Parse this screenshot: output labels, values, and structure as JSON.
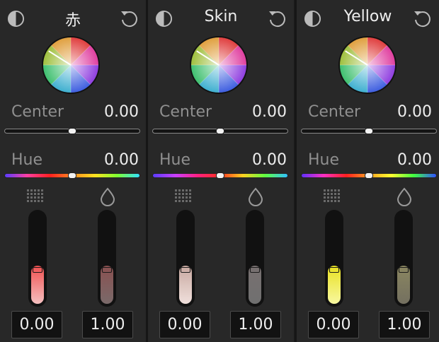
{
  "panels": [
    {
      "title": "赤",
      "center": {
        "label": "Center",
        "value": "0.00"
      },
      "hue": {
        "label": "Hue",
        "value": "0.00"
      },
      "sat_box": "0.00",
      "lum_box": "1.00",
      "sat_level": 0.42,
      "lum_level": 0.42,
      "sat_fill": [
        "#f05050",
        "#f5c0c0"
      ],
      "lum_fill": [
        "#8a5050",
        "#7a6a6a"
      ],
      "hue_colors": [
        "#5a3cff",
        "#ff3fa0",
        "#ff2020",
        "#ff8a20",
        "#ffe020",
        "#80ff30",
        "#30e0ff"
      ]
    },
    {
      "title": "Skin",
      "center": {
        "label": "Center",
        "value": "0.00"
      },
      "hue": {
        "label": "Hue",
        "value": "0.00"
      },
      "sat_box": "0.00",
      "lum_box": "1.00",
      "sat_level": 0.42,
      "lum_level": 0.42,
      "sat_fill": [
        "#c8a8a0",
        "#f0e0dc"
      ],
      "lum_fill": [
        "#787070",
        "#707070"
      ],
      "hue_colors": [
        "#5a3cff",
        "#c840ff",
        "#ff2080",
        "#ff3020",
        "#ffd020",
        "#60ff40",
        "#30c0ff"
      ]
    },
    {
      "title": "Yellow",
      "center": {
        "label": "Center",
        "value": "0.00"
      },
      "hue": {
        "label": "Hue",
        "value": "0.00"
      },
      "sat_box": "0.00",
      "lum_box": "1.00",
      "sat_level": 0.42,
      "lum_level": 0.42,
      "sat_fill": [
        "#e8e020",
        "#f8f8a0"
      ],
      "lum_fill": [
        "#8a8660",
        "#747060"
      ],
      "hue_colors": [
        "#6030ff",
        "#ff30c0",
        "#ff2020",
        "#ffa020",
        "#ffff30",
        "#40ff40",
        "#3050ff"
      ]
    }
  ],
  "icons": {
    "bypass": "half-circle-icon",
    "reset": "reset-arrow-icon",
    "saturation": "dot-grid-icon",
    "luminance": "drop-icon"
  }
}
